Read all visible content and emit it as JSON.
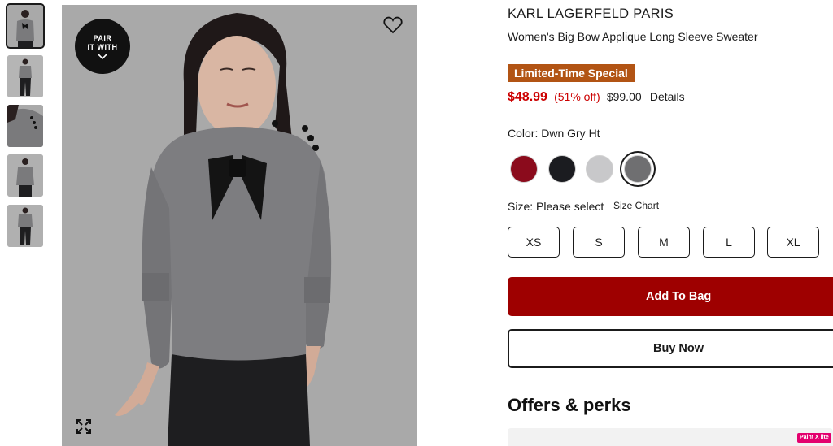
{
  "gallery": {
    "pair_with": {
      "line1": "PAIR",
      "line2": "IT WITH"
    },
    "thumbnail_count": 5,
    "active_thumbnail": 1
  },
  "product": {
    "brand": "KARL LAGERFELD PARIS",
    "name": "Women's Big Bow Applique Long Sleeve Sweater",
    "promo_badge": "Limited-Time Special",
    "price": "$48.99",
    "discount": "(51% off)",
    "original_price": "$99.00",
    "details_link": "Details"
  },
  "color": {
    "label": "Color: Dwn Gry Ht",
    "swatches": [
      {
        "color": "#8b0b1c",
        "selected": false
      },
      {
        "color": "#1b1c20",
        "selected": false
      },
      {
        "color": "#c8c8ca",
        "selected": false
      },
      {
        "color": "#6f6f71",
        "selected": true
      }
    ]
  },
  "size": {
    "label": "Size: Please select",
    "size_chart_link": "Size Chart",
    "options": [
      "XS",
      "S",
      "M",
      "L",
      "XL"
    ]
  },
  "actions": {
    "add_to_bag": "Add To Bag",
    "buy_now": "Buy Now"
  },
  "offers": {
    "title": "Offers & perks"
  },
  "extension_badge": "Paint X lite",
  "colors": {
    "promo": "#b25414",
    "sale_red": "#cc0000",
    "add_to_bag": "#9e0000",
    "image_bg": "#a9a9a9"
  }
}
